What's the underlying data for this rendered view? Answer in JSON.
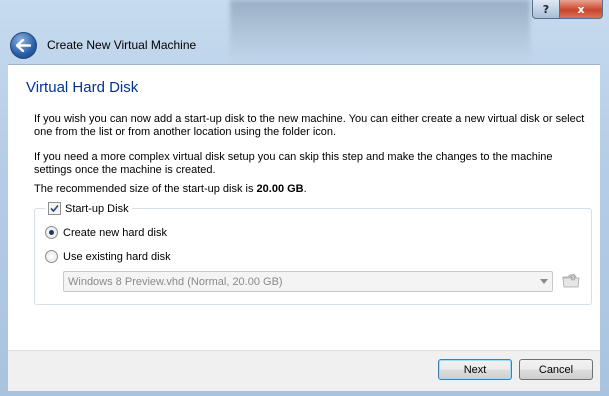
{
  "window": {
    "title": "Create New Virtual Machine",
    "help_glyph": "?",
    "close_glyph": "x"
  },
  "page": {
    "heading": "Virtual Hard Disk",
    "para1": "If you wish you can now add a start-up disk to the new machine. You can either create a new virtual disk or select one from the list or from another location using the folder icon.",
    "para2": "If you need a more complex virtual disk setup you can skip this step and make the changes to the machine settings once the machine is created.",
    "recommended_prefix": "The recommended size of the start-up disk is ",
    "recommended_size": "20.00 GB",
    "recommended_suffix": "."
  },
  "startup_disk": {
    "label": "Start-up Disk",
    "checked": true,
    "options": [
      {
        "label": "Create new hard disk",
        "selected": true
      },
      {
        "label": "Use existing hard disk",
        "selected": false
      }
    ],
    "existing_disk_value": "Windows 8 Preview.vhd (Normal, 20.00 GB)",
    "existing_disk_enabled": false
  },
  "buttons": {
    "next": "Next",
    "cancel": "Cancel"
  },
  "icons": {
    "back": "back-arrow-icon",
    "checkbox": "checkmark-icon",
    "folder": "folder-icon",
    "dropdown": "chevron-down-icon"
  },
  "colors": {
    "heading": "#003399",
    "frame": "#b6cde6",
    "default_button_border": "#3c7fb1"
  }
}
